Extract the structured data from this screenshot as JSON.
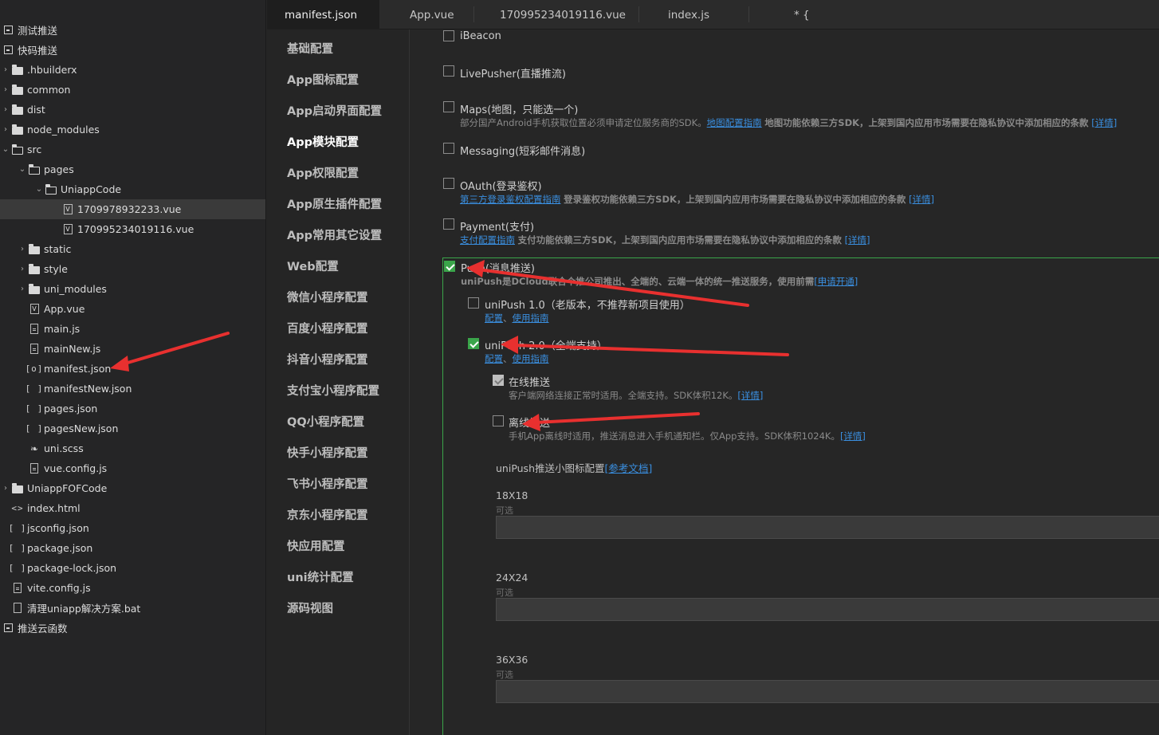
{
  "file_tree": {
    "items": [
      {
        "label": "测试推送",
        "depth": 0,
        "icon": "project-icon",
        "arrow": ""
      },
      {
        "label": "快码推送",
        "depth": 0,
        "icon": "project-icon",
        "arrow": ""
      },
      {
        "label": ".hbuilderx",
        "depth": 1,
        "icon": "folder-icon",
        "arrow": "right"
      },
      {
        "label": "common",
        "depth": 1,
        "icon": "folder-icon",
        "arrow": "right"
      },
      {
        "label": "dist",
        "depth": 1,
        "icon": "folder-icon",
        "arrow": "right"
      },
      {
        "label": "node_modules",
        "depth": 1,
        "icon": "folder-icon",
        "arrow": "right"
      },
      {
        "label": "src",
        "depth": 1,
        "icon": "folder-open-icon",
        "arrow": "down"
      },
      {
        "label": "pages",
        "depth": 2,
        "icon": "folder-open-icon",
        "arrow": "down"
      },
      {
        "label": "UniappCode",
        "depth": 3,
        "icon": "folder-open-icon",
        "arrow": "down"
      },
      {
        "label": "1709978932233.vue",
        "depth": 4,
        "icon": "vue-file-icon",
        "arrow": "",
        "selected": true
      },
      {
        "label": "170995234019116.vue",
        "depth": 4,
        "icon": "vue-file-icon",
        "arrow": ""
      },
      {
        "label": "static",
        "depth": 2,
        "icon": "folder-icon",
        "arrow": "right"
      },
      {
        "label": "style",
        "depth": 2,
        "icon": "folder-icon",
        "arrow": "right"
      },
      {
        "label": "uni_modules",
        "depth": 2,
        "icon": "folder-icon",
        "arrow": "right"
      },
      {
        "label": "App.vue",
        "depth": 2,
        "icon": "vue-file-icon",
        "arrow": ""
      },
      {
        "label": "main.js",
        "depth": 2,
        "icon": "js-file-icon",
        "arrow": ""
      },
      {
        "label": "mainNew.js",
        "depth": 2,
        "icon": "js-file-icon",
        "arrow": ""
      },
      {
        "label": "manifest.json",
        "depth": 2,
        "icon": "manifest-icon",
        "arrow": ""
      },
      {
        "label": "manifestNew.json",
        "depth": 2,
        "icon": "json-file-icon",
        "arrow": ""
      },
      {
        "label": "pages.json",
        "depth": 2,
        "icon": "json-file-icon",
        "arrow": ""
      },
      {
        "label": "pagesNew.json",
        "depth": 2,
        "icon": "json-file-icon",
        "arrow": ""
      },
      {
        "label": "uni.scss",
        "depth": 2,
        "icon": "scss-file-icon",
        "arrow": ""
      },
      {
        "label": "vue.config.js",
        "depth": 2,
        "icon": "js-file-icon",
        "arrow": ""
      },
      {
        "label": "UniappFOFCode",
        "depth": 1,
        "icon": "folder-icon",
        "arrow": "right"
      },
      {
        "label": "index.html",
        "depth": 1,
        "icon": "html-file-icon",
        "arrow": ""
      },
      {
        "label": "jsconfig.json",
        "depth": 1,
        "icon": "json-file-icon",
        "arrow": ""
      },
      {
        "label": "package.json",
        "depth": 1,
        "icon": "json-file-icon",
        "arrow": ""
      },
      {
        "label": "package-lock.json",
        "depth": 1,
        "icon": "json-file-icon",
        "arrow": ""
      },
      {
        "label": "vite.config.js",
        "depth": 1,
        "icon": "js-file-icon",
        "arrow": ""
      },
      {
        "label": "清理uniapp解决方案.bat",
        "depth": 1,
        "icon": "doc-file-icon",
        "arrow": ""
      },
      {
        "label": "推送云函数",
        "depth": 0,
        "icon": "project-icon",
        "arrow": ""
      }
    ]
  },
  "tabs": [
    {
      "label": "manifest.json",
      "active": true
    },
    {
      "label": "App.vue",
      "active": false
    },
    {
      "label": "170995234019116.vue",
      "active": false
    },
    {
      "label": "index.js",
      "active": false
    },
    {
      "label": "* {",
      "active": false
    }
  ],
  "nav": {
    "items": [
      {
        "label": "基础配置",
        "active": false
      },
      {
        "label": "App图标配置",
        "active": false
      },
      {
        "label": "App启动界面配置",
        "active": false
      },
      {
        "label": "App模块配置",
        "active": true
      },
      {
        "label": "App权限配置",
        "active": false
      },
      {
        "label": "App原生插件配置",
        "active": false
      },
      {
        "label": "App常用其它设置",
        "active": false
      },
      {
        "label": "Web配置",
        "active": false
      },
      {
        "label": "微信小程序配置",
        "active": false
      },
      {
        "label": "百度小程序配置",
        "active": false
      },
      {
        "label": "抖音小程序配置",
        "active": false
      },
      {
        "label": "支付宝小程序配置",
        "active": false
      },
      {
        "label": "QQ小程序配置",
        "active": false
      },
      {
        "label": "快手小程序配置",
        "active": false
      },
      {
        "label": "飞书小程序配置",
        "active": false
      },
      {
        "label": "京东小程序配置",
        "active": false
      },
      {
        "label": "快应用配置",
        "active": false
      },
      {
        "label": "uni统计配置",
        "active": false
      },
      {
        "label": "源码视图",
        "active": false
      }
    ]
  },
  "modules": {
    "ibeacon": {
      "label": "iBeacon",
      "checked": false
    },
    "livepusher": {
      "label": "LivePusher(直播推流)",
      "checked": false
    },
    "maps": {
      "label": "Maps(地图，只能选一个)",
      "checked": false,
      "desc_prefix": "部分国产Android手机获取位置必须申请定位服务商的SDK。",
      "desc_link": "地图配置指南",
      "desc_bold": "地图功能依赖三方SDK，上架到国内应用市场需要在隐私协议中添加相应的条款",
      "detail_link": "[详情]"
    },
    "messaging": {
      "label": "Messaging(短彩邮件消息)",
      "checked": false
    },
    "oauth": {
      "label": "OAuth(登录鉴权)",
      "checked": false,
      "desc_link": "第三方登录鉴权配置指南",
      "desc_bold": "登录鉴权功能依赖三方SDK，上架到国内应用市场需要在隐私协议中添加相应的条款",
      "detail_link": "[详情]"
    },
    "payment": {
      "label": "Payment(支付)",
      "checked": false,
      "desc_link": "支付配置指南",
      "desc_bold": "支付功能依赖三方SDK，上架到国内应用市场需要在隐私协议中添加相应的条款",
      "detail_link": "[详情]"
    },
    "push": {
      "label": "Push(消息推送)",
      "checked": true,
      "desc_bold": "uniPush是DCloud联合个推公司推出、全端的、云端一体的统一推送服务，使用前需",
      "apply_link": "[申请开通]",
      "unipush1": {
        "label": "uniPush 1.0（老版本，不推荐新项目使用）",
        "checked": false,
        "config_link": "配置",
        "sep": "、",
        "guide_link": "使用指南"
      },
      "unipush2": {
        "label": "uniPush 2.0（全端支持）",
        "checked": true,
        "config_link": "配置",
        "sep": "、",
        "guide_link": "使用指南"
      },
      "online": {
        "label": "在线推送",
        "checked": true,
        "desc": "客户端网络连接正常时适用。全端支持。SDK体积12K。",
        "detail_link": "[详情]"
      },
      "offline": {
        "label": "离线推送",
        "checked": false,
        "desc": "手机App离线时适用，推送消息进入手机通知栏。仅App支持。SDK体积1024K。",
        "detail_link": "[详情]"
      },
      "icon_config_label": "uniPush推送小图标配置",
      "icon_config_link": "[参考文档]",
      "icon_sizes": [
        {
          "label": "18X18",
          "hint": "可选",
          "value": ""
        },
        {
          "label": "24X24",
          "hint": "可选",
          "value": ""
        },
        {
          "label": "36X36",
          "hint": "可选",
          "value": ""
        }
      ]
    }
  },
  "colors": {
    "accent_green": "#3aa54a",
    "link_blue": "#3a8fe0",
    "arrow_red": "#e8302f"
  }
}
